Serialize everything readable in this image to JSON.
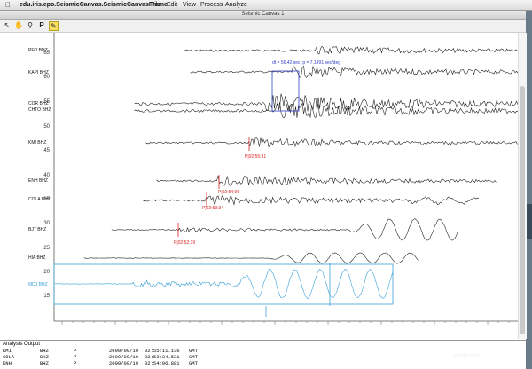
{
  "menubar": {
    "app_name": "edu.iris.epo.SeismicCanvas.SeismicCanvasFrame",
    "menus": [
      "File",
      "Edit",
      "View",
      "Process",
      "Analyze"
    ]
  },
  "window": {
    "title": "Seismic Canvas 1"
  },
  "toolbar": {
    "tools": [
      "pointer-icon",
      "hand-icon",
      "zoom-icon",
      "pick-p-icon",
      "measure-icon"
    ],
    "pick_label": "P"
  },
  "y_axis": {
    "ticks": [
      "65",
      "60",
      "55",
      "50",
      "45",
      "40",
      "35",
      "30",
      "25",
      "20",
      "15"
    ]
  },
  "stations": [
    {
      "label": "PFO BHZ",
      "color": "#111111"
    },
    {
      "label": "KAPI BHZ",
      "color": "#111111"
    },
    {
      "label": "COR BHZ",
      "color": "#111111"
    },
    {
      "label": "CHTO BHZ",
      "color": "#111111"
    },
    {
      "label": "KMI BHZ",
      "color": "#111111"
    },
    {
      "label": "ENH BHZ",
      "color": "#111111"
    },
    {
      "label": "COLA BHZ",
      "color": "#111111"
    },
    {
      "label": "BJT BHZ",
      "color": "#111111"
    },
    {
      "label": "HIA BHZ",
      "color": "#111111"
    },
    {
      "label": "MDJ BHZ",
      "color": "#3aa0d8"
    }
  ],
  "picks": [
    "P|02:55:31",
    "P|02:54:06",
    "P|02:53:34",
    "P|02:52:39"
  ],
  "measurement": "dt = 56.42 sec, p = 7.1491 sec/deg",
  "analysis_output": {
    "title": "Analysis Output",
    "rows": [
      {
        "station": "KMI",
        "channel": "BHZ",
        "phase": "P",
        "date": "2009/09/10",
        "time": "02:55:11.136",
        "tz": "GMT"
      },
      {
        "station": "COLA",
        "channel": "BHZ",
        "phase": "P",
        "date": "2009/09/10",
        "time": "02:53:34.531",
        "tz": "GMT"
      },
      {
        "station": "ENH",
        "channel": "BHZ",
        "phase": "P",
        "date": "2009/09/10",
        "time": "02:54:06.881",
        "tz": "GMT"
      }
    ]
  },
  "desktop_label": "ion Macintosh",
  "colors": {
    "trace": "#222222",
    "selected_trace": "#3aa0d8",
    "pick": "#dd2222",
    "measure": "#3340c8"
  }
}
